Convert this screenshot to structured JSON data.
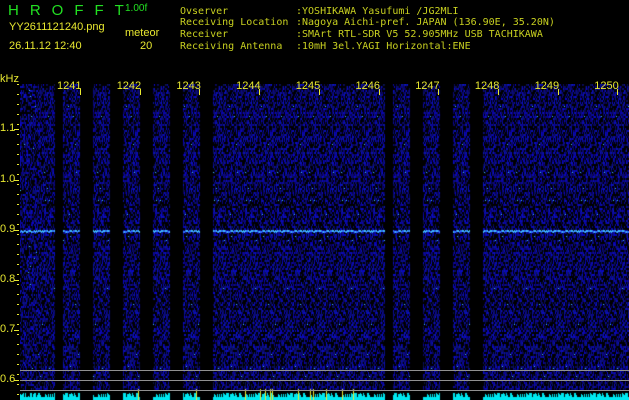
{
  "header": {
    "app_title": "HROFFT",
    "version": "1.00f",
    "filename": "YY2611121240.png",
    "datetime": "26.11.12 12:40",
    "meteor_label": "meteor",
    "meteor_count": "20"
  },
  "info": [
    {
      "label": "Ovserver",
      "value": ":YOSHIKAWA Yasufumi /JG2MLI"
    },
    {
      "label": "Receiving Location",
      "value": ":Nagoya Aichi-pref. JAPAN (136.90E, 35.20N)"
    },
    {
      "label": "Receiver",
      "value": ":SMArt RTL-SDR V5 52.905MHz USB TACHIKAWA"
    },
    {
      "label": "Receiving Antenna",
      "value": ":10mH 3el.YAGI Horizontal:ENE"
    }
  ],
  "spectrogram": {
    "y_unit": "kHz",
    "y_labels": [
      "1.1",
      "1.0",
      "0.9",
      "0.8",
      "0.7",
      "0.6"
    ],
    "x_labels": [
      "1241",
      "1242",
      "1243",
      "1244",
      "1245",
      "1246",
      "1247",
      "1248",
      "1249",
      "1250"
    ],
    "signal_freq_khz": 0.9,
    "colors": {
      "noise": "#1020c0",
      "signal": "#40c0ff",
      "histogram": "#00e8f0",
      "text": "#e8e830"
    }
  }
}
